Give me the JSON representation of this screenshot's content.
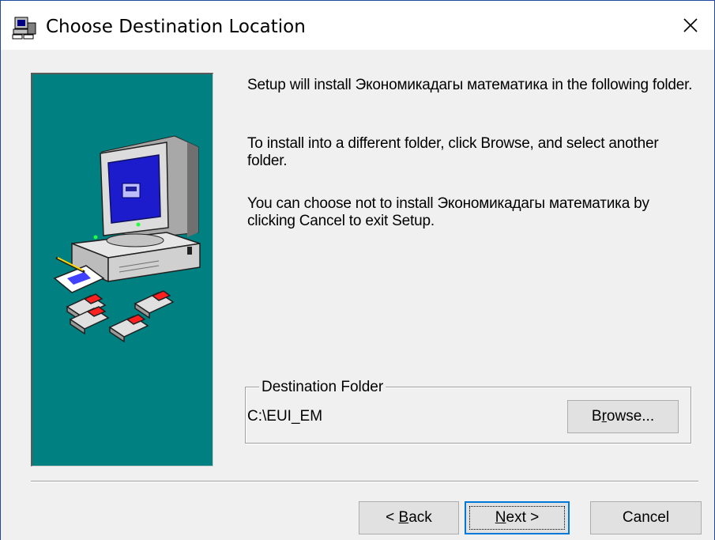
{
  "window": {
    "title": "Choose Destination Location",
    "icons": {
      "title": "setup-computer-icon",
      "close": "close-icon"
    }
  },
  "body": {
    "paragraph_1": "Setup will install Экономикадагы математика in the following folder.",
    "paragraph_2": "To install into a different folder, click Browse, and select another folder.",
    "paragraph_3": "You can choose not to install Экономикадагы математика by clicking Cancel to exit Setup."
  },
  "destination": {
    "group_label": "Destination Folder",
    "path": "C:\\EUI_EM",
    "browse": {
      "prefix": "B",
      "mnemonic": "r",
      "suffix": "owse..."
    }
  },
  "buttons": {
    "back": {
      "prefix": "< ",
      "mnemonic": "B",
      "suffix": "ack"
    },
    "next": {
      "prefix": "",
      "mnemonic": "N",
      "suffix": "ext >"
    },
    "cancel": "Cancel"
  },
  "colors": {
    "side_panel": "#008080",
    "focus_border": "#0078d7",
    "button_face": "#e1e1e1"
  }
}
